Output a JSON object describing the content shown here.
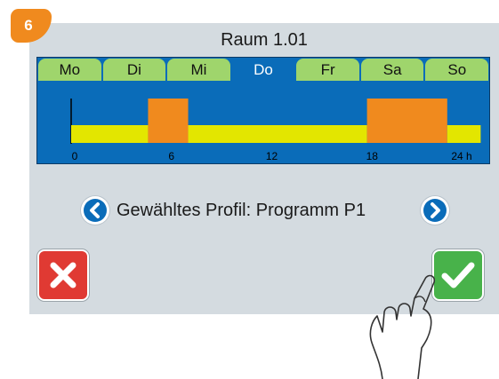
{
  "step": "6",
  "title": "Raum 1.01",
  "days": [
    {
      "label": "Mo",
      "active": false
    },
    {
      "label": "Di",
      "active": false
    },
    {
      "label": "Mi",
      "active": false
    },
    {
      "label": "Do",
      "active": true
    },
    {
      "label": "Fr",
      "active": false
    },
    {
      "label": "Sa",
      "active": false
    },
    {
      "label": "So",
      "active": false
    }
  ],
  "chart_data": {
    "type": "bar",
    "x_ticks": [
      "0",
      "6",
      "12",
      "18",
      "24 h"
    ],
    "x_range": [
      0,
      24
    ],
    "segments": [
      {
        "start": 0,
        "end": 4.6,
        "level": "low",
        "color": "#e3e600"
      },
      {
        "start": 4.6,
        "end": 7,
        "level": "high",
        "color": "#f08a1e"
      },
      {
        "start": 7,
        "end": 17.7,
        "level": "low",
        "color": "#e3e600"
      },
      {
        "start": 17.7,
        "end": 22.5,
        "level": "high",
        "color": "#f08a1e"
      },
      {
        "start": 22.5,
        "end": 24.5,
        "level": "low",
        "color": "#e3e600"
      }
    ]
  },
  "profile": {
    "label": "Gewähltes Profil: Programm P1",
    "prev_icon": "chevron-left-icon",
    "next_icon": "chevron-right-icon"
  },
  "actions": {
    "cancel_icon": "close-icon",
    "confirm_icon": "checkmark-icon"
  },
  "colors": {
    "badge": "#f08a1e",
    "schedule_bg": "#0a6cb9",
    "tab": "#9fd56c",
    "cancel": "#e03a33",
    "confirm": "#48b24a"
  }
}
